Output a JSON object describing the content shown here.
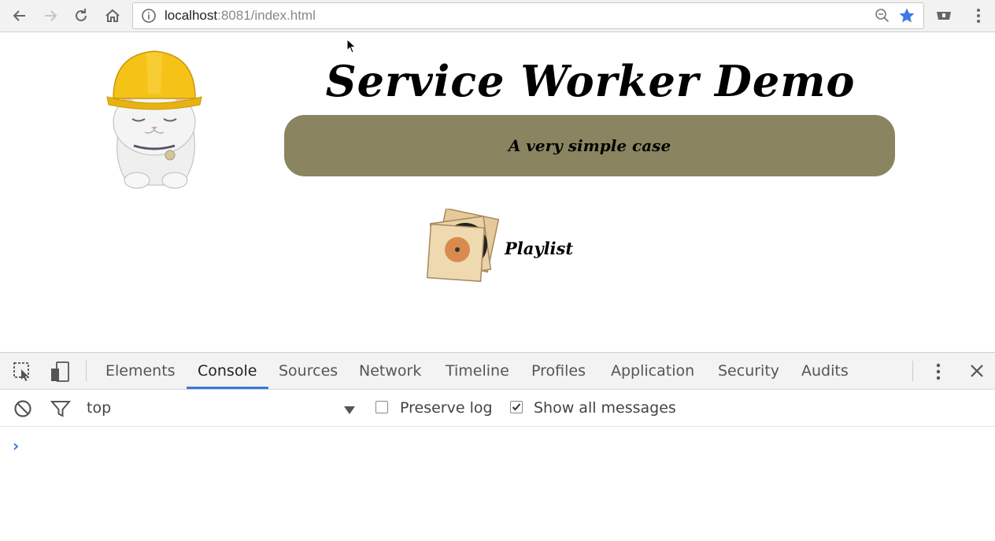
{
  "browser": {
    "url_host": "localhost",
    "url_rest": ":8081/index.html",
    "accent_star": "#3b7be0"
  },
  "page": {
    "title": "Service Worker Demo",
    "subtitle": "A very simple case",
    "playlist_label": "Playlist",
    "subtitle_bg": "#8a8560"
  },
  "devtools": {
    "tabs": [
      {
        "label": "Elements"
      },
      {
        "label": "Console",
        "active": true
      },
      {
        "label": "Sources"
      },
      {
        "label": "Network"
      },
      {
        "label": "Timeline"
      },
      {
        "label": "Profiles"
      },
      {
        "label": "Application"
      },
      {
        "label": "Security"
      },
      {
        "label": "Audits"
      }
    ],
    "context_selector": "top",
    "preserve_log_label": "Preserve log",
    "preserve_log_checked": false,
    "show_all_label": "Show all messages",
    "show_all_checked": true,
    "prompt_symbol": "›"
  }
}
